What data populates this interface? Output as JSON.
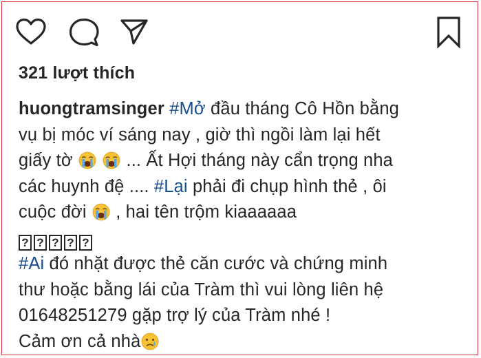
{
  "actions": {
    "like_icon": "heart-outline",
    "comment_icon": "speech-bubble",
    "share_icon": "paper-plane",
    "save_icon": "bookmark-outline"
  },
  "likes_text": "321 lượt thích",
  "caption": {
    "username": "huongtramsinger",
    "hashtag1": "#Mở",
    "line1_rest": " đầu tháng Cô Hồn bằng",
    "line2": "vụ bị móc ví sáng nay , giờ thì ngồi làm lại hết",
    "line3_start": "giấy tờ ",
    "line3_rest": " ... Ất Hợi tháng này cẩn trọng nha",
    "line4_start": "các huynh đệ .... ",
    "hashtag2": "#Lại",
    "line4_rest": " phải đi chụp hình thẻ , ôi",
    "line5_start": "cuộc đời ",
    "line5_rest": " , hai tên trộm kiaaaaaa",
    "missing_glyphs": [
      "?",
      "?",
      "?",
      "?",
      "?"
    ],
    "hashtag3": "#Ai",
    "line7_rest": " đó nhặt được thẻ căn cước và chứng minh",
    "line8": "thư hoặc bằng lái của Tràm thì vui lòng liên hệ",
    "line9": "01648251279 gặp trợ lý của Tràm nhé !",
    "line10": "Cảm ơn cả nhà",
    "emoji_crying": "loudly-crying-face",
    "emoji_sad": "crying-face"
  },
  "colors": {
    "hashtag": "#1a4e8c",
    "text": "#262626",
    "frame": "#e0303a"
  }
}
